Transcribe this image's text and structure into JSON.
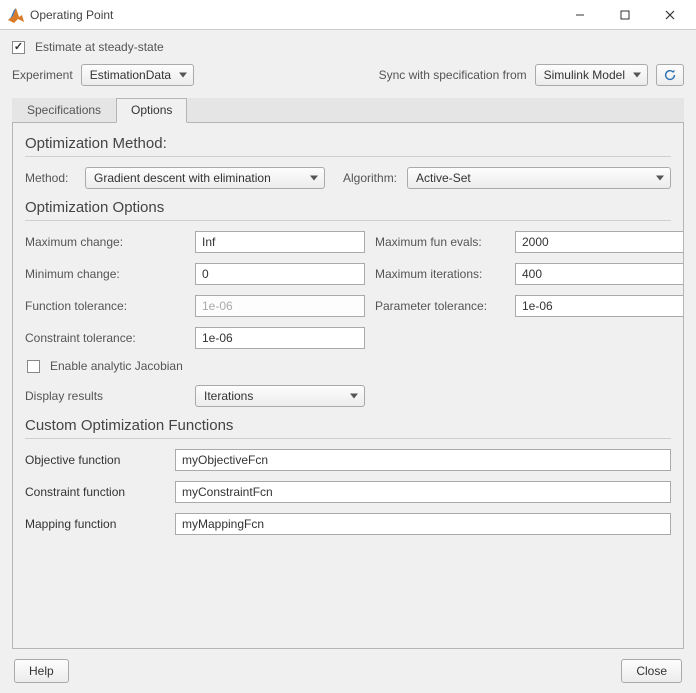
{
  "window": {
    "title": "Operating Point"
  },
  "estimate_checkbox": {
    "label": "Estimate at steady-state",
    "checked": true
  },
  "experiment": {
    "label": "Experiment",
    "value": "EstimationData"
  },
  "sync": {
    "label": "Sync with specification from",
    "value": "Simulink Model"
  },
  "tabs": {
    "specifications": "Specifications",
    "options": "Options",
    "active": "options"
  },
  "optimization_method": {
    "title": "Optimization Method:",
    "method_label": "Method:",
    "method_value": "Gradient descent with elimination",
    "algorithm_label": "Algorithm:",
    "algorithm_value": "Active-Set"
  },
  "optimization_options": {
    "title": "Optimization Options",
    "max_change": {
      "label": "Maximum change:",
      "value": "Inf"
    },
    "min_change": {
      "label": "Minimum change:",
      "value": "0"
    },
    "func_tol": {
      "label": "Function tolerance:",
      "value": "1e-06",
      "disabled": true
    },
    "con_tol": {
      "label": "Constraint tolerance:",
      "value": "1e-06"
    },
    "max_fun_evals": {
      "label": "Maximum fun evals:",
      "value": "2000"
    },
    "max_iter": {
      "label": "Maximum iterations:",
      "value": "400"
    },
    "param_tol": {
      "label": "Parameter tolerance:",
      "value": "1e-06"
    },
    "jacobian": {
      "label": "Enable analytic Jacobian",
      "checked": false
    },
    "display": {
      "label": "Display results",
      "value": "Iterations"
    }
  },
  "custom_functions": {
    "title": "Custom Optimization Functions",
    "objective": {
      "label": "Objective function",
      "value": "myObjectiveFcn"
    },
    "constraint": {
      "label": "Constraint function",
      "value": "myConstraintFcn"
    },
    "mapping": {
      "label": "Mapping function",
      "value": "myMappingFcn"
    }
  },
  "buttons": {
    "help": "Help",
    "close": "Close"
  }
}
